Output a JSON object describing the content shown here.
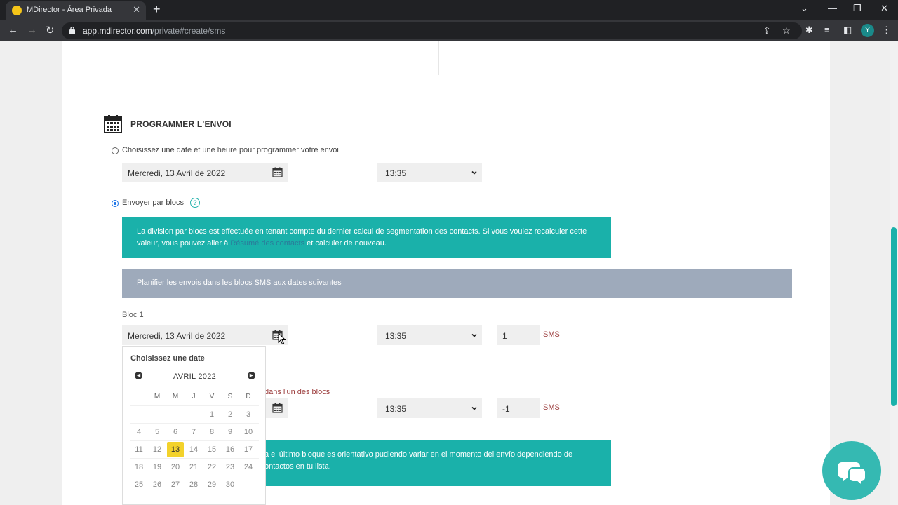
{
  "browser": {
    "tab_title": "MDirector - Área Privada",
    "url_host": "app.mdirector.com",
    "url_path": "/private#create/sms",
    "avatar_letter": "Y"
  },
  "schedule": {
    "title": "PROGRAMMER L'ENVOI",
    "option_date_label": "Choisissez une date et une heure pour programmer votre envoi",
    "date_value": "Mercredi, 13 Avril de 2022",
    "time_value": "13:35",
    "option_blocks_label": "Envoyer par blocs",
    "help_glyph": "?"
  },
  "blocks_info": {
    "text_before_link": "La division par blocs est effectuée en tenant compte du dernier calcul de segmentation des contacts. Si vous voulez recalculer cette valeur, vous pouvez aller à ",
    "link_text": "Résumé des contacts",
    "text_after_link": " et calculer de nouveau."
  },
  "plan_bar_text": "Planifier les envois dans les blocs SMS aux dates suivantes",
  "bloc1": {
    "label": "Bloc 1",
    "date_value": "Mercredi, 13 Avril de 2022",
    "time_value": "13:35",
    "count": "1",
    "unit": "SMS"
  },
  "bloc2": {
    "error_text": "dans l'un des blocs",
    "time_value": "13:35",
    "count": "-1",
    "unit": "SMS"
  },
  "note_box": {
    "line1": "a el último bloque es orientativo pudiendo variar en el momento del envío dependiendo de",
    "line2": "ontactos en tu lista."
  },
  "datepicker": {
    "title": "Choisissez une date",
    "month": "AVRIL 2022",
    "weekdays": [
      "L",
      "M",
      "M",
      "J",
      "V",
      "S",
      "D"
    ],
    "weeks": [
      [
        "",
        "",
        "",
        "",
        "1",
        "2",
        "3"
      ],
      [
        "4",
        "5",
        "6",
        "7",
        "8",
        "9",
        "10"
      ],
      [
        "11",
        "12",
        "13",
        "14",
        "15",
        "16",
        "17"
      ],
      [
        "18",
        "19",
        "20",
        "21",
        "22",
        "23",
        "24"
      ],
      [
        "25",
        "26",
        "27",
        "28",
        "29",
        "30",
        ""
      ]
    ],
    "selected_day": "13",
    "selected_color": "#f3d22b"
  },
  "colors": {
    "teal": "#1ab1aa",
    "plan_bar": "#9eaabb",
    "error": "#9b3b3b"
  }
}
